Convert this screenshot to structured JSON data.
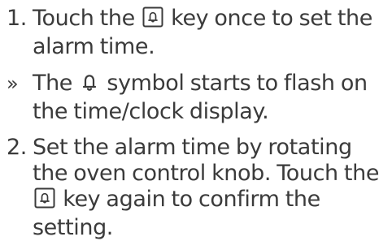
{
  "instructions": [
    {
      "marker": "1.",
      "before": "Touch the",
      "icon": "bell-key-icon",
      "after": "key once to set the alarm time."
    },
    {
      "marker": "»",
      "before": "The",
      "icon": "bell-symbol-icon",
      "after": "symbol starts to flash on the time/clock display."
    },
    {
      "marker": "2.",
      "before": "Set the alarm time by rotating the oven control knob. Touch the",
      "icon": "bell-key-icon",
      "after": "key again to confirm the setting."
    }
  ]
}
